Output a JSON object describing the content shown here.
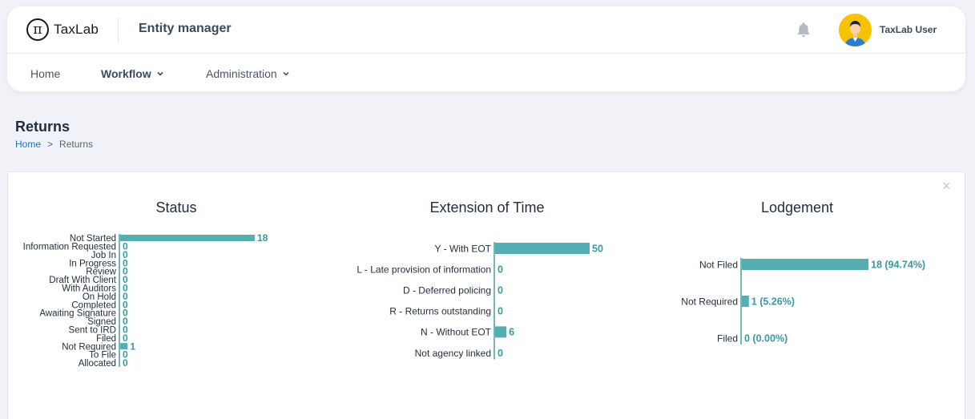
{
  "header": {
    "logo_text": "TaxLab",
    "app_title": "Entity manager",
    "user_name": "TaxLab User"
  },
  "nav": {
    "items": [
      {
        "label": "Home"
      },
      {
        "label": "Workflow"
      },
      {
        "label": "Administration"
      }
    ]
  },
  "page": {
    "title": "Returns",
    "breadcrumb": [
      {
        "label": "Home"
      },
      {
        "label": "Returns"
      }
    ],
    "breadcrumb_separator": ">"
  },
  "colors": {
    "bar": "#55aeb2",
    "bar_label": "#3a98a0",
    "axis": "#3a98a0",
    "link": "#1a73c7"
  },
  "icons": {
    "logo": "pi-circle-icon",
    "notification": "bell-icon",
    "avatar": "user-avatar",
    "dropdown": "chevron-down-icon",
    "close": "close-icon"
  },
  "chart_data": [
    {
      "type": "bar",
      "orientation": "horizontal",
      "title": "Status",
      "categories": [
        "Not Started",
        "Information Requested",
        "Job In",
        "In Progress",
        "Review",
        "Draft With Client",
        "With Auditors",
        "On Hold",
        "Completed",
        "Awaiting Signature",
        "Signed",
        "Sent to IRD",
        "Filed",
        "Not Required",
        "To File",
        "Allocated"
      ],
      "values": [
        18,
        0,
        0,
        0,
        0,
        0,
        0,
        0,
        0,
        0,
        0,
        0,
        0,
        1,
        0,
        0
      ],
      "value_labels": [
        "18",
        "0",
        "0",
        "0",
        "0",
        "0",
        "0",
        "0",
        "0",
        "0",
        "0",
        "0",
        "0",
        "1",
        "0",
        "0"
      ]
    },
    {
      "type": "bar",
      "orientation": "horizontal",
      "title": "Extension of Time",
      "categories": [
        "Y - With EOT",
        "L - Late provision of information",
        "D - Deferred policing",
        "R - Returns outstanding",
        "N - Without EOT",
        "Not agency linked"
      ],
      "values": [
        50,
        0,
        0,
        0,
        6,
        0
      ],
      "value_labels": [
        "50",
        "0",
        "0",
        "0",
        "6",
        "0"
      ]
    },
    {
      "type": "bar",
      "orientation": "horizontal",
      "title": "Lodgement",
      "categories": [
        "Not Filed",
        "Not Required",
        "Filed"
      ],
      "values": [
        18,
        1,
        0
      ],
      "value_labels": [
        "18 (94.74%)",
        "1 (5.26%)",
        "0 (0.00%)"
      ]
    }
  ]
}
